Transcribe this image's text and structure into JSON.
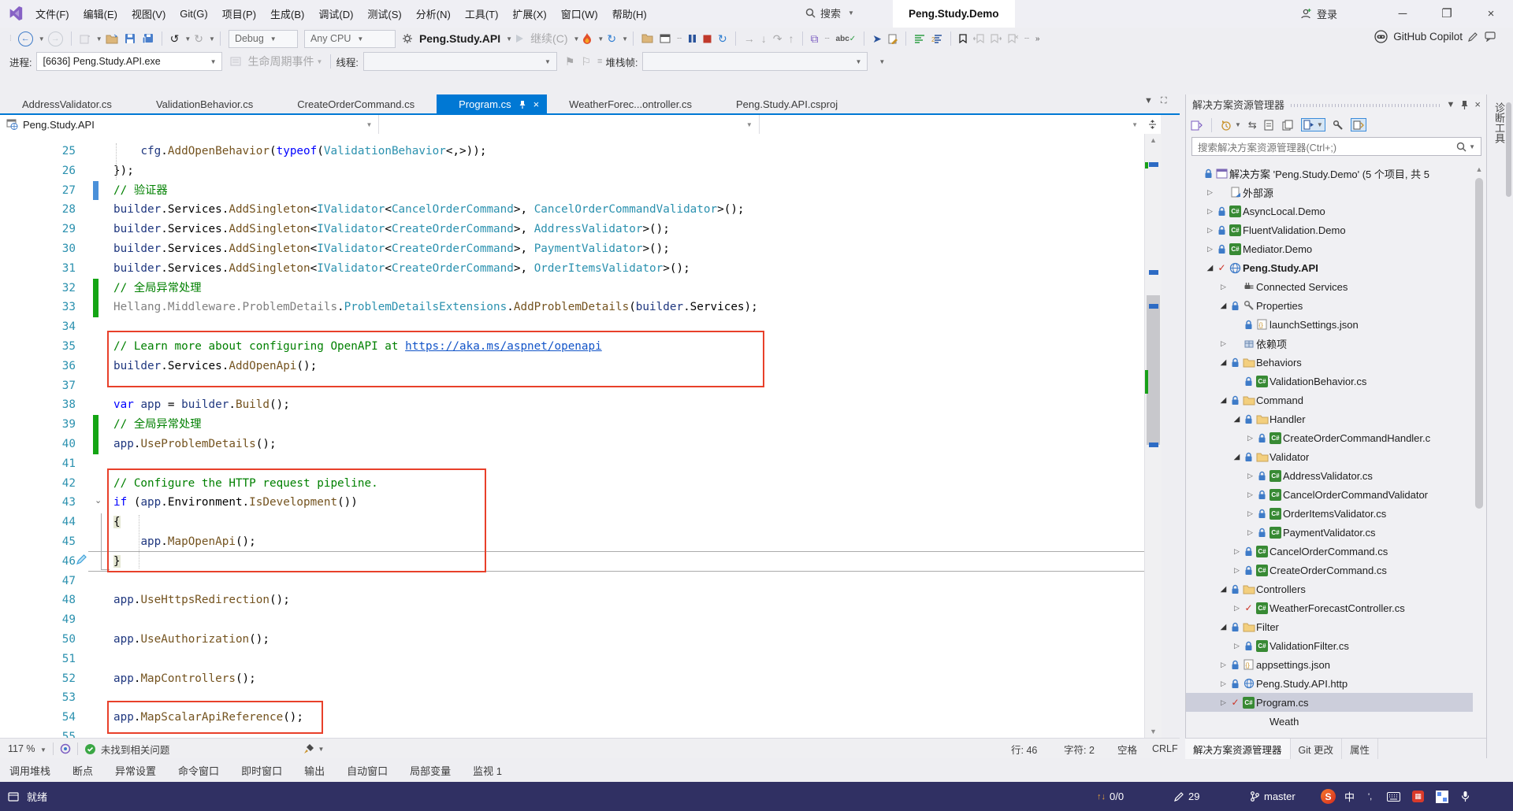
{
  "title_bar": {
    "menus": [
      "文件(F)",
      "编辑(E)",
      "视图(V)",
      "Git(G)",
      "项目(P)",
      "生成(B)",
      "调试(D)",
      "测试(S)",
      "分析(N)",
      "工具(T)",
      "扩展(X)",
      "窗口(W)",
      "帮助(H)"
    ],
    "search_label": "搜索",
    "window_title": "Peng.Study.Demo",
    "sign_in": "登录",
    "window_controls": [
      "minimize",
      "maximize",
      "close"
    ]
  },
  "toolbar": {
    "config": "Debug",
    "platform": "Any CPU",
    "startup_project": "Peng.Study.API",
    "continue_label": "继续(C)",
    "copilot_label": "GitHub Copilot"
  },
  "process_bar": {
    "process_label": "进程:",
    "process_value": "[6636] Peng.Study.API.exe",
    "lifecycle_label": "生命周期事件",
    "thread_label": "线程:",
    "stack_frame_label": "堆栈帧:"
  },
  "tabs": [
    {
      "label": "AddressValidator.cs",
      "active": false
    },
    {
      "label": "ValidationBehavior.cs",
      "active": false
    },
    {
      "label": "CreateOrderCommand.cs",
      "active": false
    },
    {
      "label": "Program.cs",
      "active": true
    },
    {
      "label": "WeatherForec...ontroller.cs",
      "active": false
    },
    {
      "label": "Peng.Study.API.csproj",
      "active": false
    }
  ],
  "breadcrumb": {
    "scope": "Peng.Study.API"
  },
  "editor": {
    "highlight_boxes": [
      {
        "lines": "35-36"
      },
      {
        "lines": "42-46"
      },
      {
        "lines": "54"
      }
    ],
    "lines": [
      {
        "n": 25,
        "segs": [
          [
            "pl",
            "    "
          ],
          [
            "lo",
            "cfg"
          ],
          [
            "pl",
            "."
          ],
          [
            "m",
            "AddOpenBehavior"
          ],
          [
            "pl",
            "("
          ],
          [
            "kw",
            "typeof"
          ],
          [
            "pl",
            "("
          ],
          [
            "ty",
            "ValidationBehavior"
          ],
          [
            "pl",
            "<,>));"
          ]
        ]
      },
      {
        "n": 26,
        "segs": [
          [
            "pl",
            "});"
          ]
        ]
      },
      {
        "n": 27,
        "bar": "blue",
        "segs": [
          [
            "cm",
            "// 验证器"
          ]
        ]
      },
      {
        "n": 28,
        "segs": [
          [
            "lo",
            "builder"
          ],
          [
            "pl",
            ".Services."
          ],
          [
            "m",
            "AddSingleton"
          ],
          [
            "pl",
            "<"
          ],
          [
            "ty",
            "IValidator"
          ],
          [
            "pl",
            "<"
          ],
          [
            "ty",
            "CancelOrderCommand"
          ],
          [
            "pl",
            ">, "
          ],
          [
            "ty",
            "CancelOrderCommandValidator"
          ],
          [
            "pl",
            ">();"
          ]
        ]
      },
      {
        "n": 29,
        "segs": [
          [
            "lo",
            "builder"
          ],
          [
            "pl",
            ".Services."
          ],
          [
            "m",
            "AddSingleton"
          ],
          [
            "pl",
            "<"
          ],
          [
            "ty",
            "IValidator"
          ],
          [
            "pl",
            "<"
          ],
          [
            "ty",
            "CreateOrderCommand"
          ],
          [
            "pl",
            ">, "
          ],
          [
            "ty",
            "AddressValidator"
          ],
          [
            "pl",
            ">();"
          ]
        ]
      },
      {
        "n": 30,
        "segs": [
          [
            "lo",
            "builder"
          ],
          [
            "pl",
            ".Services."
          ],
          [
            "m",
            "AddSingleton"
          ],
          [
            "pl",
            "<"
          ],
          [
            "ty",
            "IValidator"
          ],
          [
            "pl",
            "<"
          ],
          [
            "ty",
            "CreateOrderCommand"
          ],
          [
            "pl",
            ">, "
          ],
          [
            "ty",
            "PaymentValidator"
          ],
          [
            "pl",
            ">();"
          ]
        ]
      },
      {
        "n": 31,
        "segs": [
          [
            "lo",
            "builder"
          ],
          [
            "pl",
            ".Services."
          ],
          [
            "m",
            "AddSingleton"
          ],
          [
            "pl",
            "<"
          ],
          [
            "ty",
            "IValidator"
          ],
          [
            "pl",
            "<"
          ],
          [
            "ty",
            "CreateOrderCommand"
          ],
          [
            "pl",
            ">, "
          ],
          [
            "ty",
            "OrderItemsValidator"
          ],
          [
            "pl",
            ">();"
          ]
        ]
      },
      {
        "n": 32,
        "bar": "green",
        "segs": [
          [
            "cm",
            "// 全局异常处理"
          ]
        ]
      },
      {
        "n": 33,
        "bar": "green",
        "segs": [
          [
            "gr",
            "Hellang.Middleware.ProblemDetails"
          ],
          [
            "pl",
            "."
          ],
          [
            "ty",
            "ProblemDetailsExtensions"
          ],
          [
            "pl",
            "."
          ],
          [
            "m",
            "AddProblemDetails"
          ],
          [
            "pl",
            "("
          ],
          [
            "lo",
            "builder"
          ],
          [
            "pl",
            ".Services);"
          ]
        ]
      },
      {
        "n": 34,
        "segs": []
      },
      {
        "n": 35,
        "segs": [
          [
            "cm",
            "// Learn more about configuring OpenAPI at "
          ],
          [
            "lk",
            "https://aka.ms/aspnet/openapi"
          ]
        ]
      },
      {
        "n": 36,
        "segs": [
          [
            "lo",
            "builder"
          ],
          [
            "pl",
            ".Services."
          ],
          [
            "m",
            "AddOpenApi"
          ],
          [
            "pl",
            "();"
          ]
        ]
      },
      {
        "n": 37,
        "segs": []
      },
      {
        "n": 38,
        "segs": [
          [
            "kw",
            "var"
          ],
          [
            "pl",
            " "
          ],
          [
            "lo",
            "app"
          ],
          [
            "pl",
            " = "
          ],
          [
            "lo",
            "builder"
          ],
          [
            "pl",
            "."
          ],
          [
            "m",
            "Build"
          ],
          [
            "pl",
            "();"
          ]
        ]
      },
      {
        "n": 39,
        "bar": "green",
        "segs": [
          [
            "cm",
            "// 全局异常处理"
          ]
        ]
      },
      {
        "n": 40,
        "bar": "green",
        "segs": [
          [
            "lo",
            "app"
          ],
          [
            "pl",
            "."
          ],
          [
            "m",
            "UseProblemDetails"
          ],
          [
            "pl",
            "();"
          ]
        ]
      },
      {
        "n": 41,
        "segs": []
      },
      {
        "n": 42,
        "segs": [
          [
            "cm",
            "// Configure the HTTP request pipeline."
          ]
        ]
      },
      {
        "n": 43,
        "segs": [
          [
            "kw",
            "if"
          ],
          [
            "pl",
            " ("
          ],
          [
            "lo",
            "app"
          ],
          [
            "pl",
            ".Environment."
          ],
          [
            "m",
            "IsDevelopment"
          ],
          [
            "pl",
            "())"
          ]
        ]
      },
      {
        "n": 44,
        "segs": [
          [
            "br",
            "{"
          ]
        ]
      },
      {
        "n": 45,
        "segs": [
          [
            "pl",
            "    "
          ],
          [
            "lo",
            "app"
          ],
          [
            "pl",
            "."
          ],
          [
            "m",
            "MapOpenApi"
          ],
          [
            "pl",
            "();"
          ]
        ]
      },
      {
        "n": 46,
        "segs": [
          [
            "br",
            "}"
          ]
        ]
      },
      {
        "n": 47,
        "segs": []
      },
      {
        "n": 48,
        "segs": [
          [
            "lo",
            "app"
          ],
          [
            "pl",
            "."
          ],
          [
            "m",
            "UseHttpsRedirection"
          ],
          [
            "pl",
            "();"
          ]
        ]
      },
      {
        "n": 49,
        "segs": []
      },
      {
        "n": 50,
        "segs": [
          [
            "lo",
            "app"
          ],
          [
            "pl",
            "."
          ],
          [
            "m",
            "UseAuthorization"
          ],
          [
            "pl",
            "();"
          ]
        ]
      },
      {
        "n": 51,
        "segs": []
      },
      {
        "n": 52,
        "segs": [
          [
            "lo",
            "app"
          ],
          [
            "pl",
            "."
          ],
          [
            "m",
            "MapControllers"
          ],
          [
            "pl",
            "();"
          ]
        ]
      },
      {
        "n": 53,
        "segs": []
      },
      {
        "n": 54,
        "segs": [
          [
            "lo",
            "app"
          ],
          [
            "pl",
            "."
          ],
          [
            "m",
            "MapScalarApiReference"
          ],
          [
            "pl",
            "();"
          ]
        ]
      },
      {
        "n": 55,
        "segs": []
      }
    ]
  },
  "editor_status": {
    "zoom": "117 %",
    "problems": "未找到相关问题",
    "line_label": "行: 46",
    "col_label": "字符: 2",
    "spaces_label": "空格",
    "eol_label": "CRLF"
  },
  "bottom_panel_tabs": [
    "调用堆栈",
    "断点",
    "异常设置",
    "命令窗口",
    "即时窗口",
    "输出",
    "自动窗口",
    "局部变量",
    "监视 1"
  ],
  "status_bar": {
    "ready": "就绪",
    "sync_count": "0/0",
    "pending_edits": "29",
    "branch": "master",
    "ime_logo": "S",
    "ime_mode": "中",
    "ime_punct": "',",
    "accent": "#303063"
  },
  "solution_explorer": {
    "title": "解决方案资源管理器",
    "search_placeholder": "搜索解决方案资源管理器(Ctrl+;)",
    "bottom_tabs": [
      "解决方案资源管理器",
      "Git 更改",
      "属性"
    ],
    "tree": [
      {
        "a": null,
        "s": "lock",
        "i": "solution",
        "t": "解决方案 'Peng.Study.Demo' (5 个项目, 共 5",
        "d": 0
      },
      {
        "a": "c",
        "s": null,
        "i": "external",
        "t": "外部源",
        "d": 1
      },
      {
        "a": "c",
        "s": "lock",
        "i": "csfile",
        "t": "AsyncLocal.Demo",
        "d": 1
      },
      {
        "a": "c",
        "s": "lock",
        "i": "csfile",
        "t": "FluentValidation.Demo",
        "d": 1
      },
      {
        "a": "c",
        "s": "lock",
        "i": "csfile",
        "t": "Mediator.Demo",
        "d": 1
      },
      {
        "a": "e",
        "s": "check",
        "i": "webapp",
        "t": "Peng.Study.API",
        "d": 1,
        "bold": true
      },
      {
        "a": "c",
        "s": null,
        "i": "services",
        "t": "Connected Services",
        "d": 2
      },
      {
        "a": "e",
        "s": "lock",
        "i": "properties",
        "t": "Properties",
        "d": 2
      },
      {
        "a": null,
        "s": "lock",
        "i": "jsonfile",
        "t": "launchSettings.json",
        "d": 3
      },
      {
        "a": "c",
        "s": null,
        "i": "dependencies",
        "t": "依赖项",
        "d": 2
      },
      {
        "a": "e",
        "s": "lock",
        "i": "folder",
        "t": "Behaviors",
        "d": 2
      },
      {
        "a": null,
        "s": "lock",
        "i": "csfile",
        "t": "ValidationBehavior.cs",
        "d": 3
      },
      {
        "a": "e",
        "s": "lock",
        "i": "folder",
        "t": "Command",
        "d": 2
      },
      {
        "a": "e",
        "s": "lock",
        "i": "folder",
        "t": "Handler",
        "d": 3
      },
      {
        "a": "c",
        "s": "lock",
        "i": "csfile",
        "t": "CreateOrderCommandHandler.c",
        "d": 4
      },
      {
        "a": "e",
        "s": "lock",
        "i": "folder",
        "t": "Validator",
        "d": 3
      },
      {
        "a": "c",
        "s": "lock",
        "i": "csfile",
        "t": "AddressValidator.cs",
        "d": 4
      },
      {
        "a": "c",
        "s": "lock",
        "i": "csfile",
        "t": "CancelOrderCommandValidator",
        "d": 4
      },
      {
        "a": "c",
        "s": "lock",
        "i": "csfile",
        "t": "OrderItemsValidator.cs",
        "d": 4
      },
      {
        "a": "c",
        "s": "lock",
        "i": "csfile",
        "t": "PaymentValidator.cs",
        "d": 4
      },
      {
        "a": "c",
        "s": "lock",
        "i": "csfile",
        "t": "CancelOrderCommand.cs",
        "d": 3
      },
      {
        "a": "c",
        "s": "lock",
        "i": "csfile",
        "t": "CreateOrderCommand.cs",
        "d": 3
      },
      {
        "a": "e",
        "s": "lock",
        "i": "folder",
        "t": "Controllers",
        "d": 2
      },
      {
        "a": "c",
        "s": "check",
        "i": "csfile",
        "t": "WeatherForecastController.cs",
        "d": 3
      },
      {
        "a": "e",
        "s": "lock",
        "i": "folder",
        "t": "Filter",
        "d": 2
      },
      {
        "a": "c",
        "s": "lock",
        "i": "csfile",
        "t": "ValidationFilter.cs",
        "d": 3
      },
      {
        "a": "c",
        "s": "lock",
        "i": "jsonfile",
        "t": "appsettings.json",
        "d": 2
      },
      {
        "a": "c",
        "s": "lock",
        "i": "http",
        "t": "Peng.Study.API.http",
        "d": 2
      },
      {
        "a": "c",
        "s": "check",
        "i": "csfile",
        "t": "Program.cs",
        "d": 2,
        "sel": true
      },
      {
        "a": null,
        "s": null,
        "i": null,
        "t": "Weath",
        "d": 3
      }
    ]
  },
  "right_strip": {
    "label": "诊断工具"
  }
}
